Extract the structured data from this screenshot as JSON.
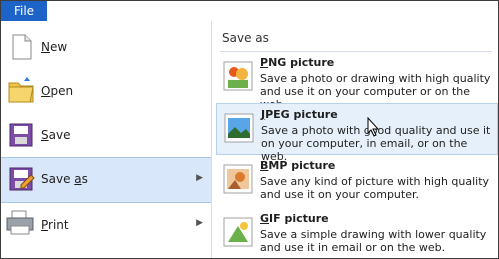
{
  "menu": {
    "file_tab": "File",
    "items": [
      {
        "label": "New",
        "mnemonic_index": 0
      },
      {
        "label": "Open",
        "mnemonic_index": 0
      },
      {
        "label": "Save",
        "mnemonic_index": 0
      },
      {
        "label": "Save as",
        "mnemonic_index": 5,
        "selected": true,
        "has_submenu": true
      },
      {
        "label": "Print",
        "mnemonic_index": 0,
        "has_submenu": true
      }
    ]
  },
  "saveas": {
    "header": "Save as",
    "options": [
      {
        "title": "PNG picture",
        "desc": "Save a photo or drawing with high quality and use it on your computer or on the web."
      },
      {
        "title": "JPEG picture",
        "desc": "Save a photo with good quality and use it on your computer, in email, or on the web."
      },
      {
        "title": "BMP picture",
        "desc": "Save any kind of picture with high quality and use it on your computer."
      },
      {
        "title": "GIF picture",
        "desc": "Save a simple drawing with lower quality and use it in email or on the web."
      }
    ]
  },
  "colors": {
    "file_tab": "#1e64c8",
    "selected_bg": "#d8e8fa",
    "hover_bg": "#e6f0fb"
  },
  "icons": {
    "new": "new-file-icon",
    "open": "open-folder-icon",
    "save": "save-disk-icon",
    "saveas": "save-as-icon",
    "print": "printer-icon",
    "png": "png-image-icon",
    "jpeg": "jpeg-image-icon",
    "bmp": "bmp-image-icon",
    "gif": "gif-image-icon"
  }
}
